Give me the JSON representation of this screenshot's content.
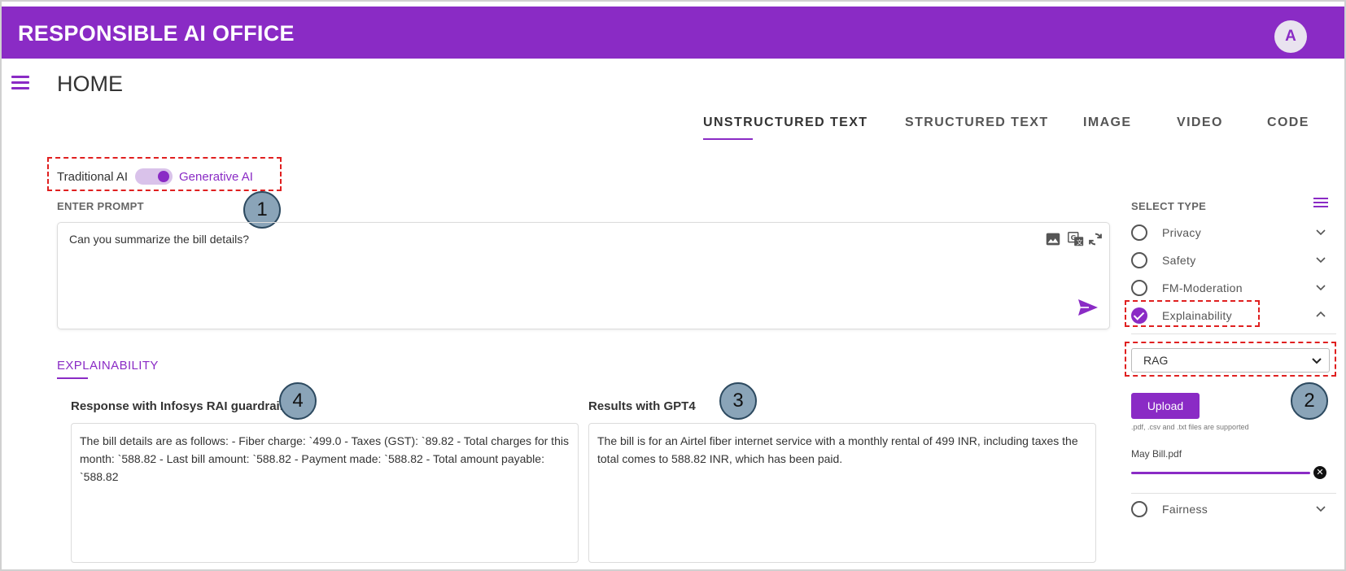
{
  "header": {
    "title": "RESPONSIBLE AI OFFICE",
    "avatar_initial": "A"
  },
  "page": {
    "title": "HOME"
  },
  "tabs": [
    {
      "label": "UNSTRUCTURED TEXT",
      "active": true
    },
    {
      "label": "STRUCTURED TEXT",
      "active": false
    },
    {
      "label": "IMAGE",
      "active": false
    },
    {
      "label": "VIDEO",
      "active": false
    },
    {
      "label": "CODE",
      "active": false
    }
  ],
  "ai_mode": {
    "left_label": "Traditional AI",
    "right_label": "Generative AI",
    "selected": "Generative AI"
  },
  "prompt": {
    "section_label": "ENTER PROMPT",
    "value": "Can you summarize the bill details?"
  },
  "result_tab": {
    "label": "EXPLAINABILITY"
  },
  "panels": {
    "guardrails": {
      "title": "Response with Infosys RAI guardrails",
      "text": "The bill details are as follows: - Fiber charge: `499.0 - Taxes (GST): `89.82 - Total charges for this month: `588.82 - Last bill amount: `588.82 - Payment made: `588.82 - Total amount payable: `588.82"
    },
    "gpt4": {
      "title": "Results with GPT4",
      "text": "The bill is for an Airtel fiber internet service with a monthly rental of 499 INR, including taxes the total comes to 588.82 INR, which has been paid."
    }
  },
  "callouts": {
    "c1": "1",
    "c2": "2",
    "c3": "3",
    "c4": "4"
  },
  "select_type": {
    "label": "SELECT TYPE",
    "items": [
      {
        "label": "Privacy",
        "checked": false
      },
      {
        "label": "Safety",
        "checked": false
      },
      {
        "label": "FM-Moderation",
        "checked": false
      },
      {
        "label": "Explainability",
        "checked": true
      },
      {
        "label": "Fairness",
        "checked": false
      }
    ],
    "method": {
      "selected": "RAG"
    },
    "upload": {
      "button_label": "Upload",
      "note": ".pdf, .csv and .txt files are supported",
      "file_name": "May Bill.pdf",
      "progress": 1.0
    }
  },
  "colors": {
    "brand": "#8a2bc5",
    "callout": "#8aa4b8",
    "highlight": "#e02020"
  }
}
